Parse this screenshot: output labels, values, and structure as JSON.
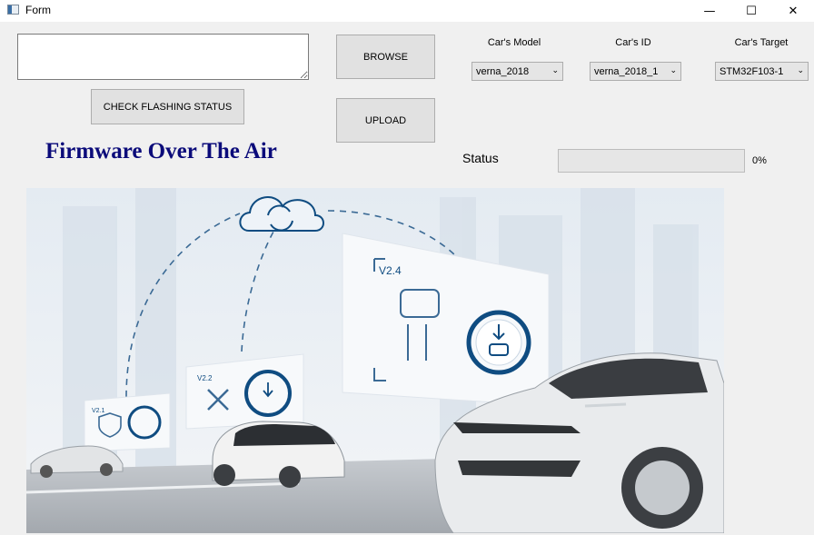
{
  "window": {
    "title": "Form"
  },
  "form": {
    "path_value": "",
    "browse_label": "BROWSE",
    "upload_label": "UPLOAD",
    "check_label": "CHECK FLASHING STATUS",
    "heading": "Firmware Over The Air",
    "status_label": "Status",
    "progress_value": 0,
    "progress_text": "0%"
  },
  "selectors": {
    "model": {
      "label": "Car's Model",
      "value": "verna_2018"
    },
    "id": {
      "label": "Car's ID",
      "value": "verna_2018_1"
    },
    "target": {
      "label": "Car's Target",
      "value": "STM32F103-1"
    }
  },
  "illustration": {
    "panel_large_version": "V2.4",
    "panel_mid_version": "V2.2",
    "panel_small_version": "V2.1"
  },
  "colors": {
    "heading": "#0b0b7a",
    "accent": "#0f4c81"
  }
}
